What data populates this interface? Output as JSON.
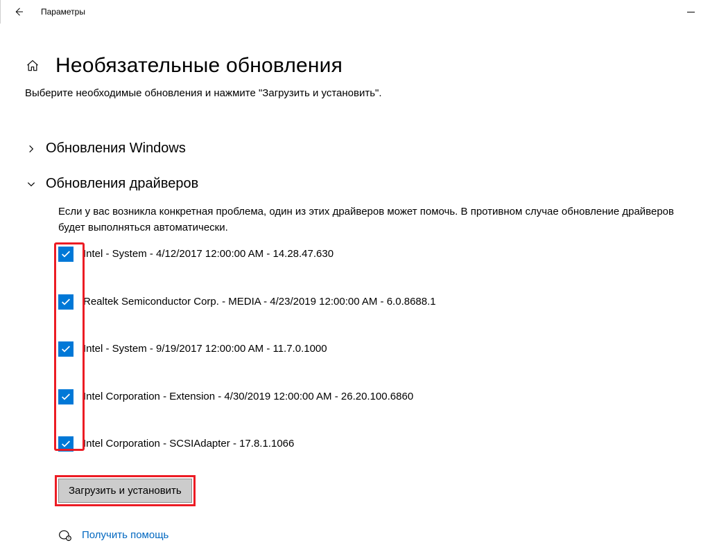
{
  "titlebar": {
    "title": "Параметры"
  },
  "header": {
    "page_title": "Необязательные обновления",
    "subtitle": "Выберите необходимые обновления и нажмите \"Загрузить и установить\"."
  },
  "sections": {
    "windows_updates": {
      "label": "Обновления Windows",
      "expanded": false
    },
    "driver_updates": {
      "label": "Обновления драйверов",
      "expanded": true,
      "description": "Если у вас возникла конкретная проблема, один из этих драйверов может помочь. В противном случае обновление драйверов будет выполняться автоматически.",
      "items": [
        {
          "checked": true,
          "label": "Intel - System - 4/12/2017 12:00:00 AM - 14.28.47.630"
        },
        {
          "checked": true,
          "label": "Realtek Semiconductor Corp. - MEDIA - 4/23/2019 12:00:00 AM - 6.0.8688.1"
        },
        {
          "checked": true,
          "label": "Intel - System - 9/19/2017 12:00:00 AM - 11.7.0.1000"
        },
        {
          "checked": true,
          "label": "Intel Corporation - Extension - 4/30/2019 12:00:00 AM - 26.20.100.6860"
        },
        {
          "checked": true,
          "label": "Intel Corporation - SCSIAdapter - 17.8.1.1066"
        }
      ]
    }
  },
  "actions": {
    "install_button": "Загрузить и установить"
  },
  "footer": {
    "get_help": "Получить помощь"
  }
}
